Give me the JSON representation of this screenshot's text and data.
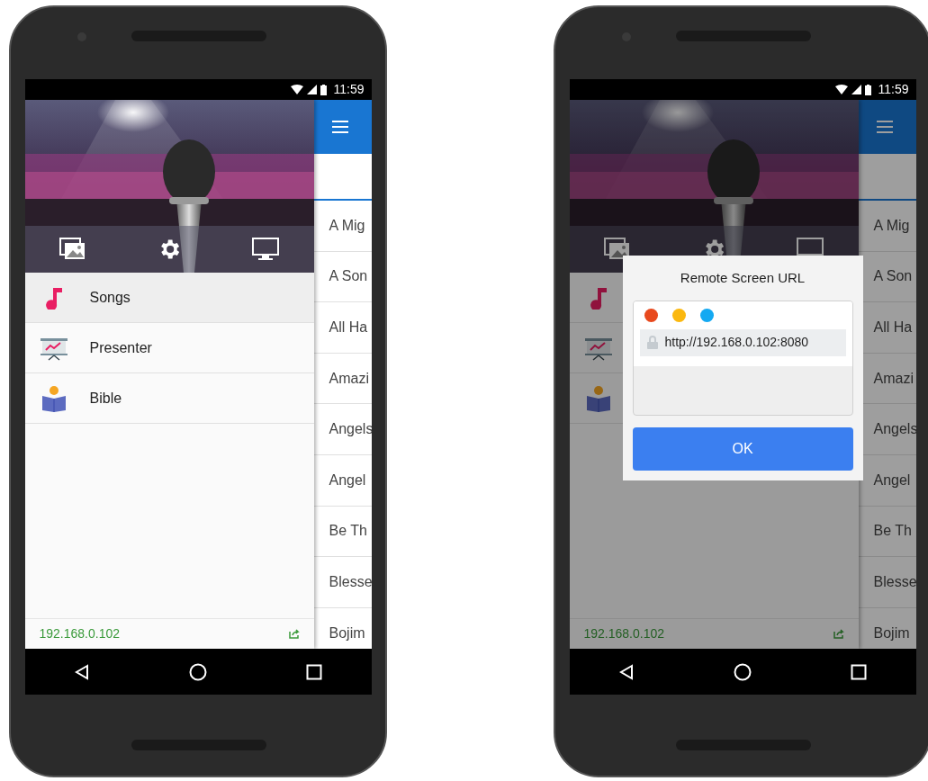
{
  "phones": [
    {
      "status_bar": {
        "time": "11:59"
      },
      "drawer": {
        "items": [
          {
            "kind": "note",
            "label": "Songs",
            "selected": true
          },
          {
            "kind": "presenter",
            "label": "Presenter",
            "selected": false
          },
          {
            "kind": "bible",
            "label": "Bible",
            "selected": false
          }
        ],
        "address": "192.168.0.102"
      },
      "song_list": [
        "A Mig",
        "A Son",
        "All Ha",
        "Amazi",
        "Angels",
        "Angel",
        "Be Th",
        "Blesse",
        "Bojim"
      ]
    },
    {
      "status_bar": {
        "time": "11:59"
      },
      "drawer": {
        "items": [
          {
            "kind": "note"
          },
          {
            "kind": "presenter"
          },
          {
            "kind": "bible"
          }
        ],
        "address": "192.168.0.102"
      },
      "song_list": [
        "A Mig",
        "A Son",
        "All Ha",
        "Amazi",
        "Angels",
        "Angel",
        "Be Th",
        "Blesse",
        "Bojim"
      ],
      "dialog": {
        "title": "Remote Screen URL",
        "url": "http://192.168.0.102:8080",
        "button": "OK"
      }
    }
  ]
}
